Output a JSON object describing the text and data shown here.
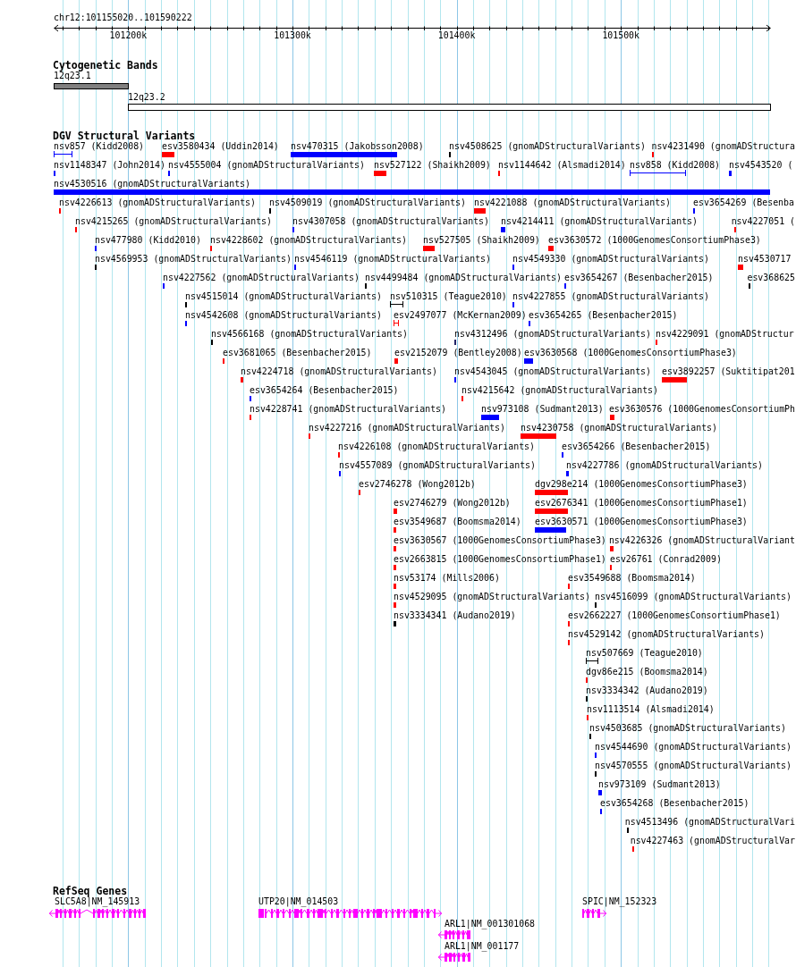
{
  "ruler": {
    "location": "chr12:101155020..101590222",
    "ticks": [
      "101200k",
      "101300k",
      "101400k",
      "101500k"
    ]
  },
  "tracks": [
    {
      "kind": "bands",
      "title": "Cytogenetic Bands",
      "bands": [
        {
          "label": "12q23.1",
          "color": "#808080"
        },
        {
          "label": "12q23.2",
          "color": "#ffffff"
        }
      ]
    },
    {
      "kind": "variants",
      "title": "DGV Structural Variants",
      "rows": [
        [
          {
            "label": "nsv857 (Kidd2008)",
            "kind": "interval",
            "color": "#0000ff"
          },
          {
            "label": "esv3580434 (Uddin2014)",
            "kind": "block",
            "color": "#ff0000"
          },
          {
            "label": "nsv470315 (Jakobsson2008)",
            "kind": "block",
            "color": "#0000ff"
          },
          {
            "label": "nsv4508625 (gnomADStructuralVariants)",
            "kind": "block",
            "color": "#000000"
          },
          {
            "label": "nsv4231490 (gnomADStructura",
            "kind": "block",
            "color": "#ff0000"
          }
        ],
        [
          {
            "label": "nsv1148347 (John2014)",
            "kind": "block",
            "color": "#0000ff"
          },
          {
            "label": "nsv4555004 (gnomADStructuralVariants)",
            "kind": "block",
            "color": "#0000ff"
          },
          {
            "label": "nsv527122 (Shaikh2009)",
            "kind": "block",
            "color": "#ff0000"
          },
          {
            "label": "nsv1144642 (Alsmadi2014)",
            "kind": "block",
            "color": "#ff0000"
          },
          {
            "label": "nsv858 (Kidd2008)",
            "kind": "interval",
            "color": "#0000ff"
          },
          {
            "label": "nsv4543520 (",
            "kind": "block",
            "color": "#0000ff"
          }
        ],
        [
          {
            "label": "nsv4530516 (gnomADStructuralVariants)",
            "kind": "block",
            "color": "#0000ff"
          }
        ],
        [
          {
            "label": "nsv4226613 (gnomADStructuralVariants)",
            "kind": "block",
            "color": "#ff0000"
          },
          {
            "label": "nsv4509019 (gnomADStructuralVariants)",
            "kind": "block",
            "color": "#000000"
          },
          {
            "label": "nsv4221088 (gnomADStructuralVariants)",
            "kind": "block",
            "color": "#ff0000"
          },
          {
            "label": "esv3654269 (Besenba",
            "kind": "block",
            "color": "#0000ff"
          }
        ],
        [
          {
            "label": "nsv4215265 (gnomADStructuralVariants)",
            "kind": "block",
            "color": "#ff0000"
          },
          {
            "label": "nsv4307058 (gnomADStructuralVariants)",
            "kind": "block",
            "color": "#0000ff"
          },
          {
            "label": "nsv4214411 (gnomADStructuralVariants)",
            "kind": "block",
            "color": "#0000ff"
          },
          {
            "label": "nsv4227051 (",
            "kind": "block",
            "color": "#ff0000"
          }
        ],
        [
          {
            "label": "nsv477980 (Kidd2010)",
            "kind": "block",
            "color": "#0000ff"
          },
          {
            "label": "nsv4228602 (gnomADStructuralVariants)",
            "kind": "block",
            "color": "#ff0000"
          },
          {
            "label": "nsv527505 (Shaikh2009)",
            "kind": "block",
            "color": "#ff0000"
          },
          {
            "label": "esv3630572 (1000GenomesConsortiumPhase3)",
            "kind": "block",
            "color": "#ff0000"
          }
        ],
        [
          {
            "label": "nsv4569953 (gnomADStructuralVariants)",
            "kind": "block",
            "color": "#000000"
          },
          {
            "label": "nsv4546119 (gnomADStructuralVariants)",
            "kind": "block",
            "color": "#0000ff"
          },
          {
            "label": "nsv4549330 (gnomADStructuralVariants)",
            "kind": "block",
            "color": "#0000ff"
          },
          {
            "label": "nsv4530717",
            "kind": "block",
            "color": "#ff0000"
          }
        ],
        [
          {
            "label": "nsv4227562 (gnomADStructuralVariants)",
            "kind": "block",
            "color": "#0000ff"
          },
          {
            "label": "nsv4499484 (gnomADStructuralVariants)",
            "kind": "block",
            "color": "#000000"
          },
          {
            "label": "esv3654267 (Besenbacher2015)",
            "kind": "block",
            "color": "#0000ff"
          },
          {
            "label": "esv368625",
            "kind": "block",
            "color": "#000000"
          }
        ],
        [
          {
            "label": "nsv4515014 (gnomADStructuralVariants)",
            "kind": "block",
            "color": "#000000"
          },
          {
            "label": "nsv510315 (Teague2010)",
            "kind": "interval",
            "color": "#000000"
          },
          {
            "label": "nsv4227855 (gnomADStructuralVariants)",
            "kind": "block",
            "color": "#0000ff"
          }
        ],
        [
          {
            "label": "nsv4542608 (gnomADStructuralVariants)",
            "kind": "block",
            "color": "#0000ff"
          },
          {
            "label": "esv2497077 (McKernan2009)",
            "kind": "interval",
            "color": "#ff0000"
          },
          {
            "label": "esv3654265 (Besenbacher2015)",
            "kind": "block",
            "color": "#0000ff"
          }
        ],
        [
          {
            "label": "nsv4566168 (gnomADStructuralVariants)",
            "kind": "block",
            "color": "#000000"
          },
          {
            "label": "nsv4312496 (gnomADStructuralVariants)",
            "kind": "block",
            "color": "#222266"
          },
          {
            "label": "nsv4229091 (gnomADStructur",
            "kind": "block",
            "color": "#ff0000"
          }
        ],
        [
          {
            "label": "esv3681065 (Besenbacher2015)",
            "kind": "block",
            "color": "#ff0000"
          },
          {
            "label": "esv2152079 (Bentley2008)",
            "kind": "block",
            "color": "#ff0000"
          },
          {
            "label": "esv3630568 (1000GenomesConsortiumPhase3)",
            "kind": "block",
            "color": "#0000ff"
          }
        ],
        [
          {
            "label": "nsv4224718 (gnomADStructuralVariants)",
            "kind": "block",
            "color": "#ff0000"
          },
          {
            "label": "nsv4543045 (gnomADStructuralVariants)",
            "kind": "block",
            "color": "#0000ff"
          },
          {
            "label": "esv3892257 (Suktitipat201",
            "kind": "block",
            "color": "#ff0000"
          }
        ],
        [
          {
            "label": "esv3654264 (Besenbacher2015)",
            "kind": "block",
            "color": "#0000ff"
          },
          {
            "label": "nsv4215642 (gnomADStructuralVariants)",
            "kind": "block",
            "color": "#ff0000"
          }
        ],
        [
          {
            "label": "nsv4228741 (gnomADStructuralVariants)",
            "kind": "block",
            "color": "#ff0000"
          },
          {
            "label": "nsv973108 (Sudmant2013)",
            "kind": "block",
            "color": "#0000ff"
          },
          {
            "label": "esv3630576 (1000GenomesConsortiumPh",
            "kind": "block",
            "color": "#ff0000"
          }
        ],
        [
          {
            "label": "nsv4227216 (gnomADStructuralVariants)",
            "kind": "block",
            "color": "#ff0000"
          },
          {
            "label": "nsv4230758 (gnomADStructuralVariants)",
            "kind": "block",
            "color": "#ff0000"
          }
        ],
        [
          {
            "label": "nsv4226108 (gnomADStructuralVariants)",
            "kind": "block",
            "color": "#ff0000"
          },
          {
            "label": "esv3654266 (Besenbacher2015)",
            "kind": "block",
            "color": "#0000ff"
          }
        ],
        [
          {
            "label": "nsv4557089 (gnomADStructuralVariants)",
            "kind": "block",
            "color": "#0000ff"
          },
          {
            "label": "nsv4227786 (gnomADStructuralVariants)",
            "kind": "block",
            "color": "#0000ff"
          }
        ],
        [
          {
            "label": "esv2746278 (Wong2012b)",
            "kind": "block",
            "color": "#ff0000"
          },
          {
            "label": "dgv298e214 (1000GenomesConsortiumPhase3)",
            "kind": "block",
            "color": "#ff0000"
          }
        ],
        [
          {
            "label": "esv2746279 (Wong2012b)",
            "kind": "block",
            "color": "#ff0000"
          },
          {
            "label": "esv2676341 (1000GenomesConsortiumPhase1)",
            "kind": "block",
            "color": "#ff0000"
          }
        ],
        [
          {
            "label": "esv3549687 (Boomsma2014)",
            "kind": "block",
            "color": "#ff0000"
          },
          {
            "label": "esv3630571 (1000GenomesConsortiumPhase3)",
            "kind": "block",
            "color": "#0000ff"
          }
        ],
        [
          {
            "label": "esv3630567 (1000GenomesConsortiumPhase3)",
            "kind": "block",
            "color": "#ff0000"
          },
          {
            "label": "nsv4226326 (gnomADStructuralVariant",
            "kind": "block",
            "color": "#ff0000"
          }
        ],
        [
          {
            "label": "esv2663815 (1000GenomesConsortiumPhase1)",
            "kind": "block",
            "color": "#ff0000"
          },
          {
            "label": "esv26761 (Conrad2009)",
            "kind": "block",
            "color": "#ff0000"
          }
        ],
        [
          {
            "label": "nsv53174 (Mills2006)",
            "kind": "block",
            "color": "#ff0000"
          },
          {
            "label": "esv3549688 (Boomsma2014)",
            "kind": "block",
            "color": "#ff0000"
          }
        ],
        [
          {
            "label": "nsv4529095 (gnomADStructuralVariants)",
            "kind": "block",
            "color": "#ff0000"
          },
          {
            "label": "nsv4516099 (gnomADStructuralVariants)",
            "kind": "block",
            "color": "#000000"
          }
        ],
        [
          {
            "label": "nsv3334341 (Audano2019)",
            "kind": "block",
            "color": "#000000"
          },
          {
            "label": "esv2662227 (1000GenomesConsortiumPhase1)",
            "kind": "block",
            "color": "#ff0000"
          }
        ],
        [
          {
            "label": "nsv4529142 (gnomADStructuralVariants)",
            "kind": "block",
            "color": "#ff0000"
          }
        ],
        [
          {
            "label": "nsv507669 (Teague2010)",
            "kind": "interval",
            "color": "#000000"
          }
        ],
        [
          {
            "label": "dgv86e215 (Boomsma2014)",
            "kind": "block",
            "color": "#ff0000"
          }
        ],
        [
          {
            "label": "nsv3334342 (Audano2019)",
            "kind": "block",
            "color": "#000000"
          }
        ],
        [
          {
            "label": "nsv1113514 (Alsmadi2014)",
            "kind": "block",
            "color": "#ff0000"
          }
        ],
        [
          {
            "label": "nsv4503685 (gnomADStructuralVariants)",
            "kind": "block",
            "color": "#000000"
          }
        ],
        [
          {
            "label": "nsv4544690 (gnomADStructuralVariants)",
            "kind": "block",
            "color": "#0000ff"
          }
        ],
        [
          {
            "label": "nsv4570555 (gnomADStructuralVariants)",
            "kind": "block",
            "color": "#000000"
          }
        ],
        [
          {
            "label": "nsv973109 (Sudmant2013)",
            "kind": "block",
            "color": "#0000ff"
          }
        ],
        [
          {
            "label": "esv3654268 (Besenbacher2015)",
            "kind": "block",
            "color": "#0000ff"
          }
        ],
        [
          {
            "label": "nsv4513496 (gnomADStructuralVari",
            "kind": "block",
            "color": "#000000"
          }
        ],
        [
          {
            "label": "nsv4227463 (gnomADStructuralVar",
            "kind": "block",
            "color": "#ff0000"
          }
        ]
      ]
    },
    {
      "kind": "genes",
      "title": "RefSeq Genes",
      "genes": [
        {
          "label": "SLC5A8|NM_145913",
          "reverse": true
        },
        {
          "label": "UTP20|NM_014503",
          "reverse": false
        },
        {
          "label": "SPIC|NM_152323",
          "reverse": false
        },
        {
          "label": "ARL1|NM_001301068",
          "reverse": true
        },
        {
          "label": "ARL1|NM_001177",
          "reverse": true
        }
      ]
    }
  ]
}
